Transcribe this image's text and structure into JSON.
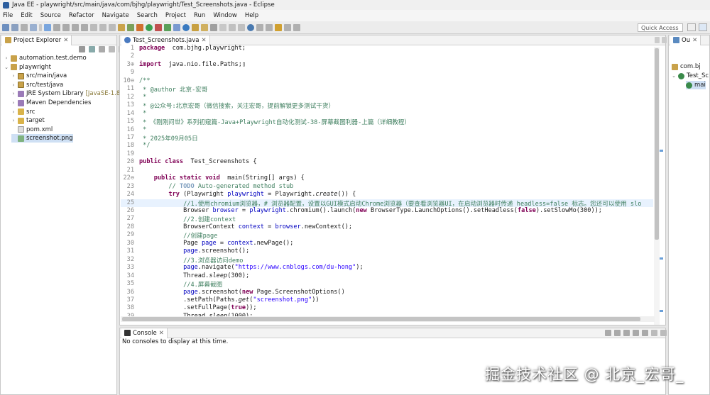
{
  "window": {
    "title": "Java EE - playwright/src/main/java/com/bjhg/playwright/Test_Screenshots.java - Eclipse"
  },
  "menu": [
    "File",
    "Edit",
    "Source",
    "Refactor",
    "Navigate",
    "Search",
    "Project",
    "Run",
    "Window",
    "Help"
  ],
  "toolbar": {
    "quick_access": "Quick Access"
  },
  "project_explorer": {
    "title": "Project Explorer",
    "items": [
      {
        "label": "automation.test.demo",
        "indent": 0,
        "arrow": ">",
        "icon": "project-icon"
      },
      {
        "label": "playwright",
        "indent": 0,
        "arrow": "v",
        "icon": "project-icon"
      },
      {
        "label": "src/main/java",
        "indent": 1,
        "arrow": ">",
        "icon": "source-folder-icon"
      },
      {
        "label": "src/test/java",
        "indent": 1,
        "arrow": ">",
        "icon": "source-folder-icon"
      },
      {
        "label": "JRE System Library",
        "suffix": "[JavaSE-1.8]",
        "indent": 1,
        "arrow": ">",
        "icon": "library-icon"
      },
      {
        "label": "Maven Dependencies",
        "indent": 1,
        "arrow": ">",
        "icon": "library-icon"
      },
      {
        "label": "src",
        "indent": 1,
        "arrow": ">",
        "icon": "folder-icon"
      },
      {
        "label": "target",
        "indent": 1,
        "arrow": ">",
        "icon": "folder-icon"
      },
      {
        "label": "pom.xml",
        "indent": 1,
        "arrow": "",
        "icon": "xml-file-icon"
      },
      {
        "label": "screenshot.png",
        "indent": 1,
        "arrow": "",
        "icon": "image-file-icon",
        "selected": true
      }
    ]
  },
  "editor": {
    "tab": "Test_Screenshots.java",
    "lines": [
      {
        "n": "1",
        "t": [
          [
            "kw",
            "package"
          ],
          [
            "",
            "  com.bjhg.playwright;"
          ]
        ]
      },
      {
        "n": "2",
        "t": []
      },
      {
        "n": "3⊕",
        "t": [
          [
            "kw",
            "import"
          ],
          [
            "",
            "  java.nio.file.Paths;▯"
          ]
        ]
      },
      {
        "n": "9",
        "t": []
      },
      {
        "n": "10⊖",
        "t": [
          [
            "cm",
            "/**"
          ]
        ]
      },
      {
        "n": "11",
        "t": [
          [
            "cm",
            " * @author 北京-宏哥"
          ]
        ]
      },
      {
        "n": "12",
        "t": [
          [
            "cm",
            " *"
          ]
        ]
      },
      {
        "n": "13",
        "t": [
          [
            "cm",
            " * @公众号:北京宏哥（微信搜索，关注宏哥，提前解锁更多测试干货）"
          ]
        ]
      },
      {
        "n": "14",
        "t": [
          [
            "cm",
            " *"
          ]
        ]
      },
      {
        "n": "15",
        "t": [
          [
            "cm",
            " * 《刚刚问世》系列初窥篇-Java+Playwright自动化测试-38-屏幕截图利器-上篇（详细教程）"
          ]
        ]
      },
      {
        "n": "16",
        "t": [
          [
            "cm",
            " *"
          ]
        ]
      },
      {
        "n": "17",
        "t": [
          [
            "cm",
            " * 2025年09月05日"
          ]
        ]
      },
      {
        "n": "18",
        "t": [
          [
            "cm",
            " */"
          ]
        ]
      },
      {
        "n": "19",
        "t": []
      },
      {
        "n": "20",
        "t": [
          [
            "kw",
            "public class"
          ],
          [
            "",
            "  Test_Screenshots {"
          ]
        ]
      },
      {
        "n": "21",
        "t": []
      },
      {
        "n": "22⊖",
        "t": [
          [
            "",
            "    "
          ],
          [
            "kw",
            "public static void"
          ],
          [
            "",
            "  main(String[] args) {"
          ]
        ]
      },
      {
        "n": "23",
        "t": [
          [
            "",
            "        "
          ],
          [
            "cm",
            "// "
          ],
          [
            "cmtodo",
            "TODO"
          ],
          [
            "cm",
            " Auto-generated method stub"
          ]
        ]
      },
      {
        "n": "24",
        "t": [
          [
            "",
            "        "
          ],
          [
            "kw",
            "try"
          ],
          [
            "",
            " (Playwright "
          ],
          [
            "var",
            "playwright"
          ],
          [
            "",
            " = Playwright."
          ],
          [
            "it",
            "create"
          ],
          [
            "",
            "()) {"
          ]
        ]
      },
      {
        "n": "25",
        "t": [
          [
            "",
            "            "
          ],
          [
            "cm",
            "//1.使用chromium浏览器，# 浏览器配置，设置以GUI模式启动Chrome浏览器（要查看浏览器UI，在启动浏览器时传递 headless=false 标志。您还可以使用 slo"
          ]
        ],
        "cursor": true
      },
      {
        "n": "26",
        "t": [
          [
            "",
            "            Browser "
          ],
          [
            "var",
            "browser"
          ],
          [
            "",
            " = "
          ],
          [
            "var",
            "playwright"
          ],
          [
            "",
            ".chromium().launch("
          ],
          [
            "kw",
            "new"
          ],
          [
            "",
            " BrowserType.LaunchOptions().setHeadless("
          ],
          [
            "kw",
            "false"
          ],
          [
            "",
            ").setSlowMo(300));"
          ]
        ]
      },
      {
        "n": "27",
        "t": [
          [
            "",
            "            "
          ],
          [
            "cm",
            "//2.创建context"
          ]
        ]
      },
      {
        "n": "28",
        "t": [
          [
            "",
            "            BrowserContext "
          ],
          [
            "var",
            "context"
          ],
          [
            "",
            " = "
          ],
          [
            "var",
            "browser"
          ],
          [
            "",
            ".newContext();"
          ]
        ]
      },
      {
        "n": "29",
        "t": [
          [
            "",
            "            "
          ],
          [
            "cm",
            "//创建page"
          ]
        ]
      },
      {
        "n": "30",
        "t": [
          [
            "",
            "            Page "
          ],
          [
            "var",
            "page"
          ],
          [
            "",
            " = "
          ],
          [
            "var",
            "context"
          ],
          [
            "",
            ".newPage();"
          ]
        ]
      },
      {
        "n": "31",
        "t": [
          [
            "",
            "            "
          ],
          [
            "var",
            "page"
          ],
          [
            "",
            ".screenshot();"
          ]
        ]
      },
      {
        "n": "32",
        "t": [
          [
            "",
            "            "
          ],
          [
            "cm",
            "//3.浏览器访问demo"
          ]
        ]
      },
      {
        "n": "33",
        "t": [
          [
            "",
            "            "
          ],
          [
            "var",
            "page"
          ],
          [
            "",
            ".navigate("
          ],
          [
            "str",
            "\"https://www.cnblogs.com/du-hong\""
          ],
          [
            "",
            ");"
          ]
        ]
      },
      {
        "n": "34",
        "t": [
          [
            "",
            "            Thread."
          ],
          [
            "it",
            "sleep"
          ],
          [
            "",
            "(300);"
          ]
        ]
      },
      {
        "n": "35",
        "t": [
          [
            "",
            "            "
          ],
          [
            "cm",
            "//4.屏幕截图"
          ]
        ]
      },
      {
        "n": "36",
        "t": [
          [
            "",
            "            "
          ],
          [
            "var",
            "page"
          ],
          [
            "",
            ".screenshot("
          ],
          [
            "kw",
            "new"
          ],
          [
            "",
            " Page.ScreenshotOptions()"
          ]
        ]
      },
      {
        "n": "37",
        "t": [
          [
            "",
            "            .setPath(Paths."
          ],
          [
            "it",
            "get"
          ],
          [
            "",
            "("
          ],
          [
            "str",
            "\"screenshot.png\""
          ],
          [
            "",
            "))"
          ]
        ]
      },
      {
        "n": "38",
        "t": [
          [
            "",
            "            .setFullPage("
          ],
          [
            "kw",
            "true"
          ],
          [
            "",
            "));"
          ]
        ]
      },
      {
        "n": "39",
        "t": [
          [
            "",
            "            Thread."
          ],
          [
            "it",
            "sleep"
          ],
          [
            "",
            "(1000);"
          ]
        ]
      }
    ]
  },
  "outline": {
    "title": "Ou",
    "items": [
      {
        "label": "com.bj",
        "icon": "package-icon"
      },
      {
        "label": "Test_Sc",
        "icon": "class-icon",
        "arrow": "v"
      },
      {
        "label": "mai",
        "icon": "method-icon",
        "selected": true
      }
    ]
  },
  "console": {
    "title": "Console",
    "message": "No consoles to display at this time."
  },
  "watermark": "掘金技术社区 @ 北京_宏哥_",
  "colors": {
    "keyword": "#7f0055",
    "comment": "#3f7f5f",
    "string": "#2a00ff",
    "field": "#0000c0",
    "selection": "#cfe0f4"
  }
}
